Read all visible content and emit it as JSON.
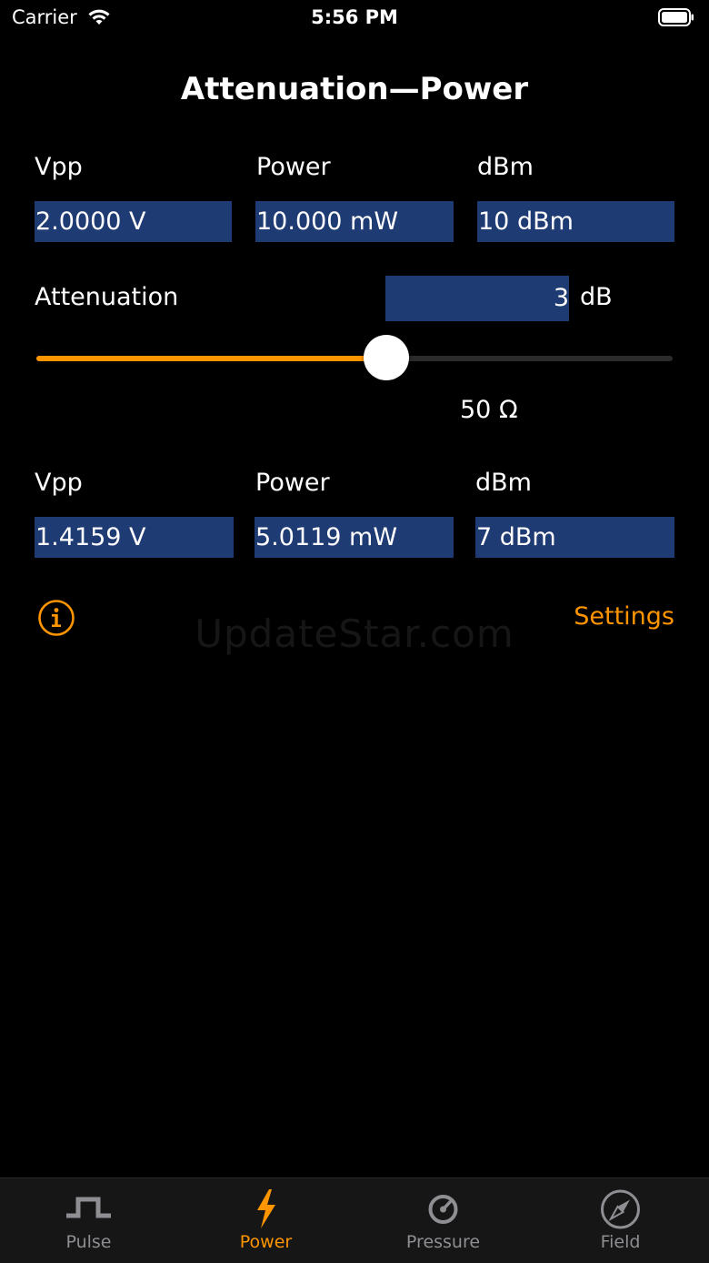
{
  "status_bar": {
    "carrier": "Carrier",
    "time": "5:56 PM"
  },
  "title": "Attenuation—Power",
  "input": {
    "vpp_label": "Vpp",
    "power_label": "Power",
    "dbm_label": "dBm",
    "vpp_value": "2.0000 V",
    "power_value": "10.000 mW",
    "dbm_value": "10 dBm"
  },
  "attenuation": {
    "label": "Attenuation",
    "value": "3",
    "unit": "dB",
    "slider_fraction": 0.55
  },
  "impedance": "50 Ω",
  "output": {
    "vpp_label": "Vpp",
    "power_label": "Power",
    "dbm_label": "dBm",
    "vpp_value": "1.4159 V",
    "power_value": "5.0119 mW",
    "dbm_value": "7 dBm"
  },
  "settings_label": "Settings",
  "watermark": "UpdateStar.com",
  "tabs": [
    {
      "label": "Pulse",
      "icon": "pulse-icon",
      "active": false
    },
    {
      "label": "Power",
      "icon": "lightning-icon",
      "active": true
    },
    {
      "label": "Pressure",
      "icon": "gauge-icon",
      "active": false
    },
    {
      "label": "Field",
      "icon": "compass-icon",
      "active": false
    }
  ],
  "colors": {
    "accent": "#ff9500",
    "field_bg": "#1f3b73",
    "background": "#000000",
    "tab_inactive": "#8e8e93"
  }
}
